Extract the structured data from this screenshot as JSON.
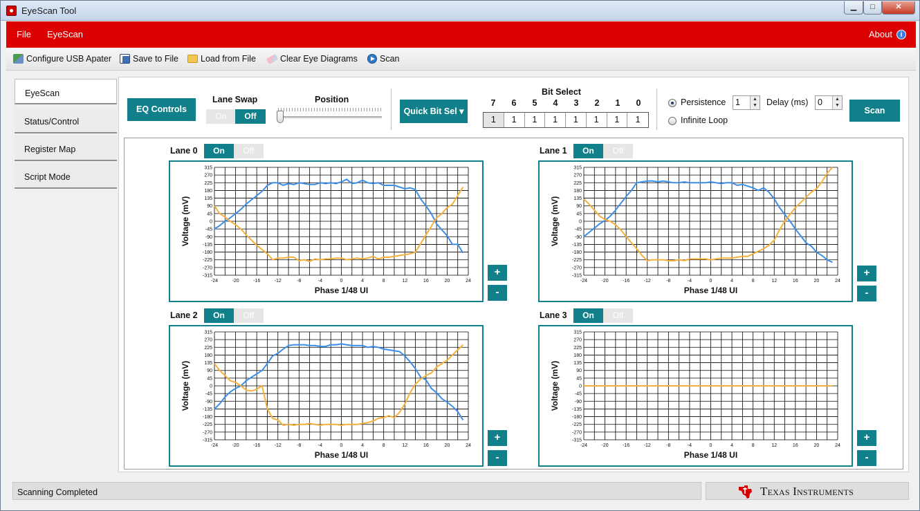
{
  "window": {
    "title": "EyeScan Tool",
    "min_glyph": "▁",
    "max_glyph": "□",
    "close_glyph": "✕"
  },
  "menu": {
    "file": "File",
    "eyescan": "EyeScan",
    "about": "About",
    "info_glyph": "i"
  },
  "toolbar": {
    "configure": "Configure USB Apater",
    "save": "Save to File",
    "load": "Load from File",
    "clear": "Clear Eye Diagrams",
    "scan": "Scan"
  },
  "nav": {
    "eyescan": "EyeScan",
    "status": "Status/Control",
    "register": "Register Map",
    "script": "Script Mode"
  },
  "controls": {
    "eq_controls": "EQ Controls",
    "lane_swap": "Lane Swap",
    "lane_swap_on": "On",
    "lane_swap_off": "Off",
    "position": "Position",
    "position_level": 0,
    "quick_bit_sel": "Quick Bit Sel ▾",
    "bit_select": "Bit Select",
    "bit_labels": [
      "7",
      "6",
      "5",
      "4",
      "3",
      "2",
      "1",
      "0"
    ],
    "bit_values": [
      "1",
      "1",
      "1",
      "1",
      "1",
      "1",
      "1",
      "1"
    ],
    "persistence": "Persistence",
    "persistence_value": "1",
    "delay_label": "Delay (ms)",
    "delay_value": "0",
    "infinite_loop": "Infinite Loop",
    "scan": "Scan"
  },
  "lanes": [
    {
      "label": "Lane 0",
      "on": "On",
      "off": "Off"
    },
    {
      "label": "Lane 1",
      "on": "On",
      "off": "Off"
    },
    {
      "label": "Lane 2",
      "on": "On",
      "off": "Off"
    },
    {
      "label": "Lane 3",
      "on": "On",
      "off": "Off"
    }
  ],
  "zoom": {
    "plus": "+",
    "minus": "-"
  },
  "status": {
    "message": "Scanning Completed",
    "brand": "Texas Instruments"
  },
  "colors": {
    "teal": "#12808a",
    "red": "#dc0000",
    "blue": "#3b8ee8",
    "orange": "#f6b03a"
  },
  "icons": {
    "app": "app-icon",
    "configure": "usb-adapter-icon",
    "save": "save-disk-icon",
    "load": "folder-icon",
    "clear": "eraser-icon",
    "scan": "play-icon",
    "about": "info-icon",
    "brand": "ti-logo-icon"
  },
  "chart_data": [
    {
      "type": "line",
      "lane": "Lane 0",
      "xlabel": "Phase 1/48 UI",
      "ylabel": "Voltage (mV)",
      "xlim": [
        -24,
        24
      ],
      "ylim": [
        -315,
        315
      ],
      "xticks": [
        -24,
        -20,
        -16,
        -12,
        -8,
        -4,
        0,
        4,
        8,
        12,
        16,
        20,
        24
      ],
      "yticks": [
        315,
        270,
        225,
        180,
        135,
        90,
        45,
        0,
        -45,
        -90,
        -135,
        -180,
        -225,
        -270,
        -315
      ],
      "x": [
        -24,
        -23,
        -22,
        -21,
        -20,
        -19,
        -18,
        -17,
        -16,
        -15,
        -14,
        -13,
        -12,
        -11,
        -10,
        -9,
        -8,
        -7,
        -6,
        -5,
        -4,
        -3,
        -2,
        -1,
        0,
        1,
        2,
        3,
        4,
        5,
        6,
        7,
        8,
        9,
        10,
        11,
        12,
        13,
        14,
        15,
        16,
        17,
        18,
        19,
        20,
        21,
        22,
        23
      ],
      "series": [
        {
          "values": [
            -45,
            -25,
            0,
            20,
            45,
            70,
            100,
            125,
            150,
            175,
            210,
            225,
            225,
            210,
            220,
            215,
            225,
            220,
            215,
            215,
            225,
            220,
            225,
            220,
            230,
            245,
            220,
            225,
            240,
            225,
            220,
            225,
            210,
            210,
            210,
            200,
            190,
            195,
            185,
            130,
            90,
            45,
            -15,
            -50,
            -85,
            -135,
            -135,
            -185
          ]
        },
        {
          "values": [
            90,
            45,
            25,
            0,
            -20,
            -45,
            -80,
            -110,
            -140,
            -165,
            -190,
            -225,
            -215,
            -215,
            -210,
            -210,
            -230,
            -225,
            -235,
            -220,
            -225,
            -220,
            -220,
            -215,
            -215,
            -225,
            -220,
            -215,
            -220,
            -215,
            -205,
            -220,
            -210,
            -210,
            -205,
            -200,
            -195,
            -190,
            -180,
            -130,
            -80,
            -30,
            20,
            45,
            80,
            100,
            150,
            200
          ]
        }
      ]
    },
    {
      "type": "line",
      "lane": "Lane 1",
      "xlabel": "Phase 1/48 UI",
      "ylabel": "Voltage (mV)",
      "xlim": [
        -24,
        24
      ],
      "ylim": [
        -315,
        315
      ],
      "xticks": [
        -24,
        -20,
        -16,
        -12,
        -8,
        -4,
        0,
        4,
        8,
        12,
        16,
        20,
        24
      ],
      "yticks": [
        315,
        270,
        225,
        180,
        135,
        90,
        45,
        0,
        -45,
        -90,
        -135,
        -180,
        -225,
        -270,
        -315
      ],
      "x": [
        -24,
        -23,
        -22,
        -21,
        -20,
        -19,
        -18,
        -17,
        -16,
        -15,
        -14,
        -13,
        -12,
        -11,
        -10,
        -9,
        -8,
        -7,
        -6,
        -5,
        -4,
        -3,
        -2,
        -1,
        0,
        1,
        2,
        3,
        4,
        5,
        6,
        7,
        8,
        9,
        10,
        11,
        12,
        13,
        14,
        15,
        16,
        17,
        18,
        19,
        20,
        21,
        22,
        23
      ],
      "series": [
        {
          "values": [
            -90,
            -65,
            -40,
            -15,
            5,
            30,
            65,
            105,
            145,
            180,
            225,
            230,
            235,
            235,
            230,
            235,
            230,
            225,
            225,
            230,
            225,
            225,
            225,
            225,
            230,
            225,
            220,
            225,
            225,
            210,
            215,
            205,
            195,
            180,
            195,
            170,
            130,
            80,
            40,
            0,
            -45,
            -85,
            -125,
            -145,
            -180,
            -200,
            -225,
            -240
          ]
        },
        {
          "values": [
            130,
            100,
            65,
            30,
            10,
            0,
            -20,
            -50,
            -90,
            -125,
            -160,
            -200,
            -230,
            -225,
            -225,
            -225,
            -230,
            -230,
            -225,
            -230,
            -220,
            -220,
            -220,
            -220,
            -225,
            -220,
            -215,
            -215,
            -215,
            -210,
            -205,
            -205,
            -190,
            -175,
            -160,
            -140,
            -110,
            -50,
            0,
            40,
            80,
            110,
            140,
            170,
            190,
            230,
            280,
            315
          ]
        }
      ]
    },
    {
      "type": "line",
      "lane": "Lane 2",
      "xlabel": "Phase 1/48 UI",
      "ylabel": "Voltage (mV)",
      "xlim": [
        -24,
        24
      ],
      "ylim": [
        -315,
        315
      ],
      "xticks": [
        -24,
        -20,
        -16,
        -12,
        -8,
        -4,
        0,
        4,
        8,
        12,
        16,
        20,
        24
      ],
      "yticks": [
        315,
        270,
        225,
        180,
        135,
        90,
        45,
        0,
        -45,
        -90,
        -135,
        -180,
        -225,
        -270,
        -315
      ],
      "x": [
        -24,
        -23,
        -22,
        -21,
        -20,
        -19,
        -18,
        -17,
        -16,
        -15,
        -14,
        -13,
        -12,
        -11,
        -10,
        -9,
        -8,
        -7,
        -6,
        -5,
        -4,
        -3,
        -2,
        -1,
        0,
        1,
        2,
        3,
        4,
        5,
        6,
        7,
        8,
        9,
        10,
        11,
        12,
        13,
        14,
        15,
        16,
        17,
        18,
        19,
        20,
        21,
        22,
        23
      ],
      "series": [
        {
          "values": [
            -135,
            -105,
            -65,
            -35,
            -15,
            0,
            30,
            50,
            70,
            90,
            130,
            175,
            190,
            215,
            235,
            240,
            240,
            240,
            235,
            235,
            230,
            230,
            240,
            240,
            245,
            240,
            235,
            235,
            235,
            225,
            230,
            225,
            215,
            210,
            205,
            200,
            175,
            140,
            100,
            50,
            35,
            -15,
            -40,
            -75,
            -95,
            -120,
            -150,
            -200
          ]
        },
        {
          "values": [
            130,
            90,
            60,
            30,
            20,
            0,
            -25,
            -30,
            -20,
            0,
            -135,
            -190,
            -200,
            -230,
            -225,
            -230,
            -225,
            -225,
            -220,
            -225,
            -230,
            -225,
            -225,
            -225,
            -230,
            -225,
            -225,
            -225,
            -220,
            -215,
            -205,
            -190,
            -185,
            -175,
            -185,
            -155,
            -105,
            -40,
            10,
            40,
            60,
            75,
            110,
            130,
            150,
            180,
            210,
            240
          ]
        }
      ]
    },
    {
      "type": "line",
      "lane": "Lane 3",
      "xlabel": "Phase 1/48 UI",
      "ylabel": "Voltage (mV)",
      "xlim": [
        -24,
        24
      ],
      "ylim": [
        -315,
        315
      ],
      "xticks": [
        -24,
        -20,
        -16,
        -12,
        -8,
        -4,
        0,
        4,
        8,
        12,
        16,
        20,
        24
      ],
      "yticks": [
        315,
        270,
        225,
        180,
        135,
        90,
        45,
        0,
        -45,
        -90,
        -135,
        -180,
        -225,
        -270,
        -315
      ],
      "x": [
        -24,
        23
      ],
      "series": [
        {
          "values": [
            0,
            0
          ]
        }
      ]
    }
  ]
}
